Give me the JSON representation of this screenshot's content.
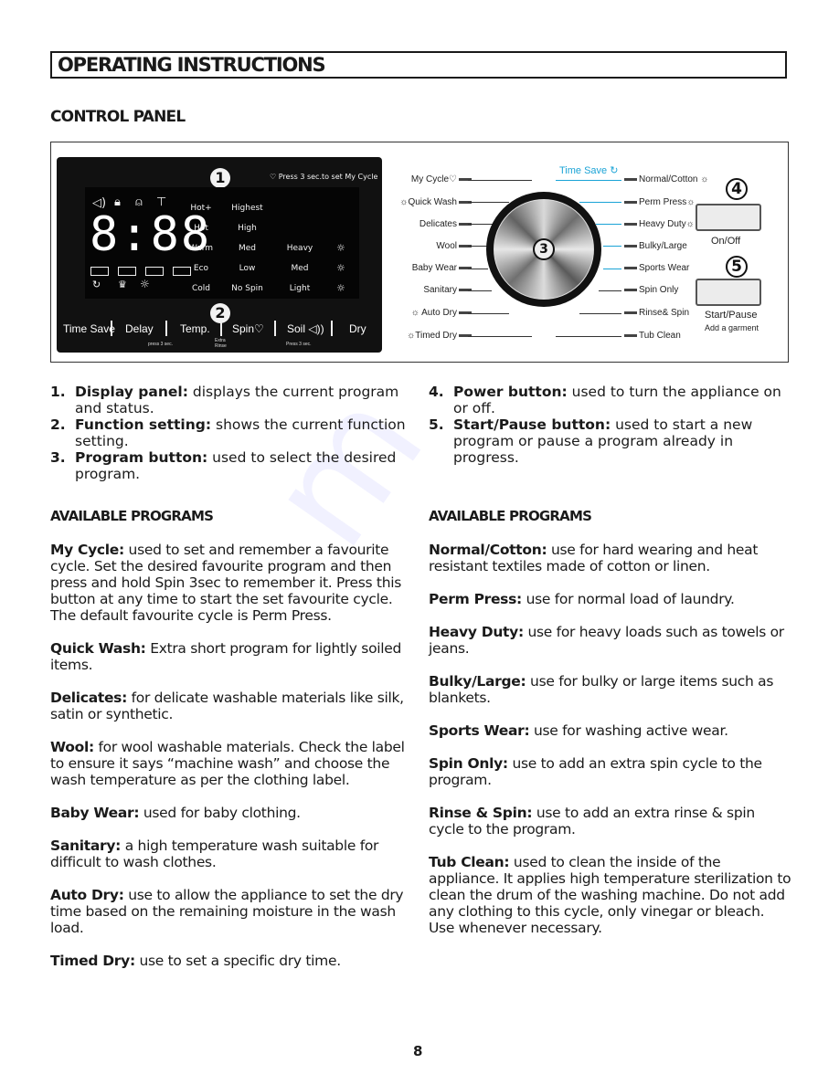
{
  "header": {
    "title": "OPERATING INSTRUCTIONS",
    "section": "CONTROL PANEL"
  },
  "display": {
    "callout": "1",
    "my_cycle_hint": "Press 3 sec.to set My Cycle",
    "digits": "8:88",
    "top_icons": [
      "speaker-icon",
      "lock-icon",
      "child-lock-icon",
      "shirt-add-icon"
    ],
    "middle_icons": [
      "wash-icon",
      "rinse-icon",
      "spin-icon",
      "dry-icon"
    ],
    "bottom_icons": [
      "time-save-icon",
      "tub-icon",
      "sun-icon"
    ],
    "temp_levels": [
      "Hot+",
      "Hot",
      "Warm",
      "Eco",
      "Cold"
    ],
    "spin_levels": [
      "Highest",
      "High",
      "Med",
      "Low",
      "No Spin"
    ],
    "soil_levels": [
      "Heavy",
      "Med",
      "Light"
    ],
    "dry_icons": [
      "dry-heavy-icon",
      "dry-med-icon",
      "dry-light-icon"
    ]
  },
  "functions": {
    "callout": "2",
    "buttons": [
      {
        "label": "Time Save"
      },
      {
        "label": "Delay"
      },
      {
        "label": "Temp."
      },
      {
        "label": "Spin♡"
      },
      {
        "label": "Soil ◁))"
      },
      {
        "label": "Dry"
      }
    ],
    "hint_press3": "press 3 sec.",
    "hint_extra_rinse": "Extra Rinse",
    "hint_soil": "Press 3 sec."
  },
  "programs_dial": {
    "callout": "3",
    "time_save_label": "Time Save",
    "left": [
      {
        "label": "My Cycle♡"
      },
      {
        "label": "☼Quick Wash"
      },
      {
        "label": "Delicates"
      },
      {
        "label": "Wool"
      },
      {
        "label": "Baby Wear"
      },
      {
        "label": "Sanitary"
      },
      {
        "label": "☼ Auto Dry"
      },
      {
        "label": "☼Timed Dry"
      }
    ],
    "right": [
      {
        "label": "Normal/Cotton ☼"
      },
      {
        "label": "Perm Press☼"
      },
      {
        "label": "Heavy Duty☼"
      },
      {
        "label": "Bulky/Large"
      },
      {
        "label": "Sports Wear"
      },
      {
        "label": "Spin Only"
      },
      {
        "label": "Rinse& Spin"
      },
      {
        "label": "Tub Clean"
      }
    ],
    "accent_color": "#1aa3d6"
  },
  "power": {
    "callout": "4",
    "label": "On/Off"
  },
  "start": {
    "callout": "5",
    "label": "Start/Pause",
    "sublabel": "Add a garment"
  },
  "legend": [
    {
      "n": "1.",
      "term": "Display panel:",
      "desc": " displays the current program and status."
    },
    {
      "n": "2.",
      "term": "Function setting:",
      "desc": " shows the current function setting."
    },
    {
      "n": "3.",
      "term": "Program button:",
      "desc": " used to select the desired program."
    },
    {
      "n": "4.",
      "term": "Power button:",
      "desc": " used to turn the appliance on or off."
    },
    {
      "n": "5.",
      "term": "Start/Pause button:",
      "desc": " used to start a new program or pause a program already in progress."
    }
  ],
  "available_programs_heading": "AVAILABLE PROGRAMS",
  "programs_left": [
    {
      "term": "My Cycle:",
      "desc": " used to set and remember a favourite cycle. Set the desired favourite program and then press and hold Spin 3sec to remember it. Press this button at any time to start the set favourite cycle. The default favourite cycle is Perm Press."
    },
    {
      "term": "Quick Wash:",
      "desc": " Extra short program for lightly soiled items."
    },
    {
      "term": "Delicates:",
      "desc": " for delicate washable materials like silk, satin or synthetic."
    },
    {
      "term": "Wool:",
      "desc": " for wool washable materials. Check the label to ensure it says “machine wash” and choose the wash temperature as per the clothing label."
    },
    {
      "term": "Baby Wear:",
      "desc": " used for baby clothing."
    },
    {
      "term": "Sanitary:",
      "desc": " a high temperature wash suitable for difficult to wash clothes."
    },
    {
      "term": "Auto Dry:",
      "desc": " use to allow the appliance to set the dry time based on the remaining moisture in the wash load."
    },
    {
      "term": "Timed Dry:",
      "desc": " use to set a specific dry time."
    }
  ],
  "programs_right": [
    {
      "term": "Normal/Cotton:",
      "desc": " use for hard wearing and heat resistant textiles made of cotton or linen."
    },
    {
      "term": "Perm Press:",
      "desc": " use for normal load of laundry."
    },
    {
      "term": "Heavy Duty:",
      "desc": " use for heavy loads such as towels or jeans."
    },
    {
      "term": "Bulky/Large:",
      "desc": " use for bulky or large items such as blankets."
    },
    {
      "term": "Sports Wear:",
      "desc": " use for washing active wear."
    },
    {
      "term": "Spin Only:",
      "desc": " use to add an extra spin cycle to the program."
    },
    {
      "term": "Rinse & Spin:",
      "desc": " use to add an extra rinse & spin cycle to the program."
    },
    {
      "term": "Tub Clean:",
      "desc": " used to clean the inside of the appliance. It applies high temperature sterilization to clean the drum of the washing machine. Do not add any clothing to this cycle, only vinegar or bleach. Use whenever necessary."
    }
  ],
  "page_number": "8"
}
